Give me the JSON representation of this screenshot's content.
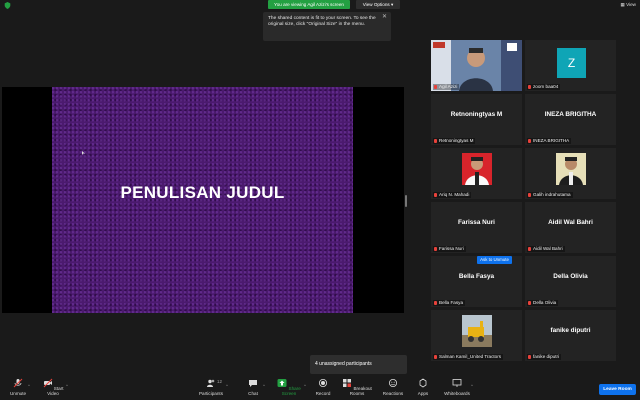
{
  "topbar": {
    "share_banner": "You are viewing Agil Azizi's screen",
    "view_options": "View Options",
    "view": "View"
  },
  "tooltip": {
    "text": "The shared content is fit to your screen. To see the original size, click \"Original Size\" in the menu."
  },
  "slide": {
    "title": "PENULISAN JUDUL"
  },
  "gallery": {
    "tiles": [
      {
        "label": "Agil Azizi"
      },
      {
        "label": "zoom baa04",
        "avatar_letter": "Z"
      },
      {
        "big_name": "Retnoningtyas M",
        "label": "Retnoningtyas M"
      },
      {
        "big_name": "INEZA BRIGITHA",
        "label": "INEZA BRIGITHA"
      },
      {
        "label": "Ariq N. Mahadi"
      },
      {
        "label": "Galih indrahutama"
      },
      {
        "big_name": "Farissa Nuri",
        "label": "Farissa Nuri"
      },
      {
        "big_name": "Aidil Wal Bahri",
        "label": "Aidil Wal Bahri"
      },
      {
        "big_name": "Bella Fasya",
        "label": "Bella Fasya"
      },
      {
        "big_name": "Della Olivia",
        "label": "Della Olivia"
      },
      {
        "label": "Salman Kamil_United Tractors"
      },
      {
        "big_name": "fanike diputri",
        "label": "fanike diputri"
      }
    ],
    "ask_to_unmute": "Ask to Unmute"
  },
  "unassigned": "4 unassigned participants",
  "toolbar": {
    "unmute": "Unmute",
    "start_video": "Start Video",
    "participants": "Participants",
    "participants_count": "12",
    "chat": "Chat",
    "share_screen": "Share Screen",
    "record": "Record",
    "breakout_rooms": "Breakout Rooms",
    "reactions": "Reactions",
    "apps": "Apps",
    "whiteboards": "Whiteboards",
    "leave": "Leave Room"
  },
  "colors": {
    "accent_green": "#23a042",
    "accent_blue": "#0e72ed",
    "slide_purple": "#4b1a6e",
    "avatar_teal": "#0fa5b6",
    "active_speaker": "#b7d92c"
  }
}
